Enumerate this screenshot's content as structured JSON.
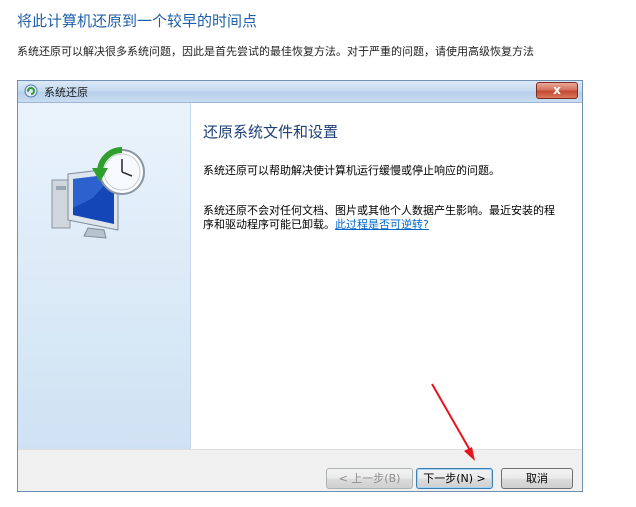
{
  "page": {
    "heading": "将此计算机还原到一个较早的时间点",
    "description": "系统还原可以解决很多系统问题，因此是首先尝试的最佳恢复方法。对于严重的问题，请使用高级恢复方法"
  },
  "window": {
    "title": "系统还原",
    "close_label": "x"
  },
  "dialog": {
    "heading": "还原系统文件和设置",
    "para1": "系统还原可以帮助解决使计算机运行缓慢或停止响应的问题。",
    "para2": "系统还原不会对任何文档、图片或其他个人数据产生影响。最近安装的程序和驱动程序可能已卸载。",
    "link": "此过程是否可逆转?"
  },
  "buttons": {
    "back": "< 上一步(B)",
    "next": "下一步(N) >",
    "cancel": "取消"
  },
  "colors": {
    "heading_blue": "#1f5fa8",
    "annotation_arrow": "#e8141c"
  },
  "icons": {
    "title": "system-restore-icon",
    "illustration": "computer-restore-clock-icon"
  }
}
